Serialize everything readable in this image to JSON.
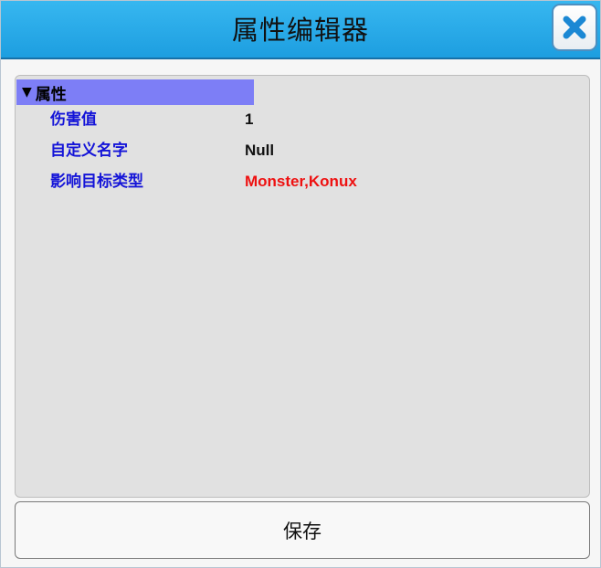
{
  "window": {
    "title": "属性编辑器"
  },
  "property_grid": {
    "group_label": "属性",
    "rows": [
      {
        "name": "伤害值",
        "value": "1"
      },
      {
        "name": "自定义名字",
        "value": "Null"
      },
      {
        "name": "影响目标类型",
        "value": "Monster,Konux"
      }
    ]
  },
  "footer": {
    "save_label": "保存"
  },
  "icons": {
    "close": "close-icon",
    "collapse": "triangle-down-icon"
  },
  "colors": {
    "titlebar": "#1d9ee0",
    "group_header": "#7d7ef6",
    "property_name": "#1414d8",
    "highlight_value": "#ee1111"
  }
}
